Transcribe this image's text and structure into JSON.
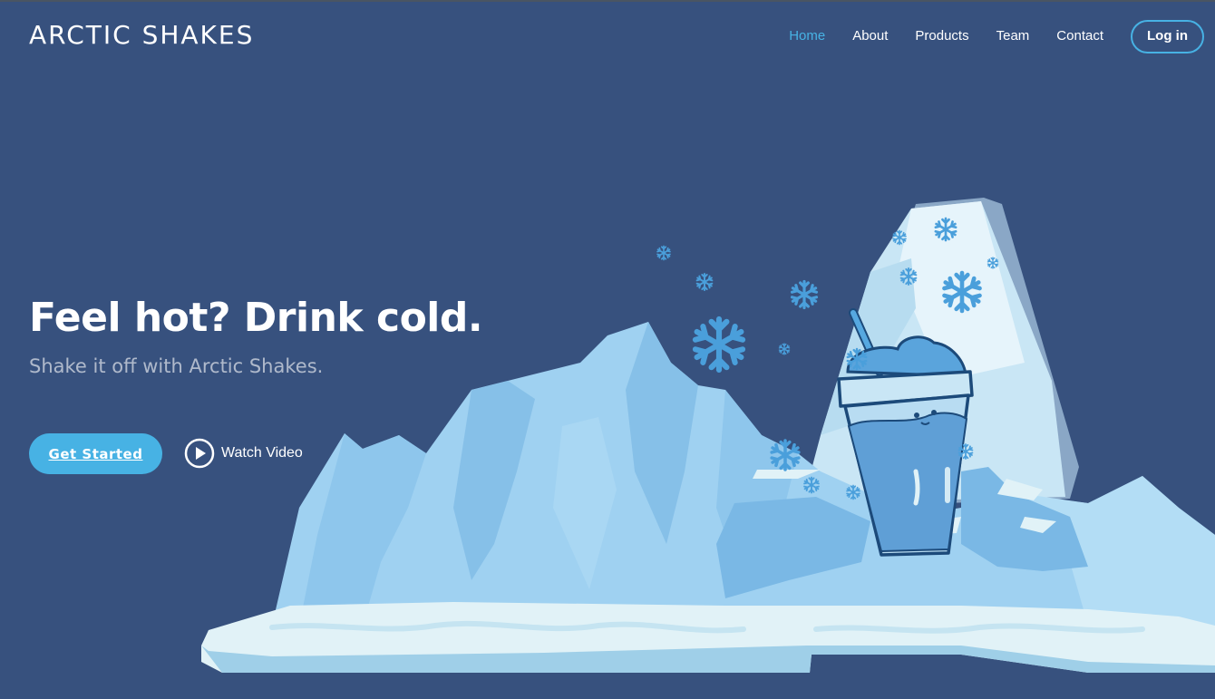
{
  "header": {
    "logo": "ARCTIC SHAKES",
    "nav": [
      {
        "label": "Home",
        "active": true
      },
      {
        "label": "About"
      },
      {
        "label": "Products"
      },
      {
        "label": "Team"
      },
      {
        "label": "Contact"
      }
    ],
    "login_label": "Log in"
  },
  "hero": {
    "title": "Feel hot? Drink cold.",
    "subtitle": "Shake it off with Arctic Shakes.",
    "cta_label": "Get Started",
    "video_label": "Watch Video"
  },
  "colors": {
    "background": "#37517e",
    "accent": "#47b2e4",
    "ice_light": "#e1f2f7",
    "ice_mid": "#9dd1f0",
    "ice_dark": "#7ab9e6"
  },
  "icons": {
    "play": "play-circle-icon",
    "snowflake": "snowflake-icon"
  }
}
